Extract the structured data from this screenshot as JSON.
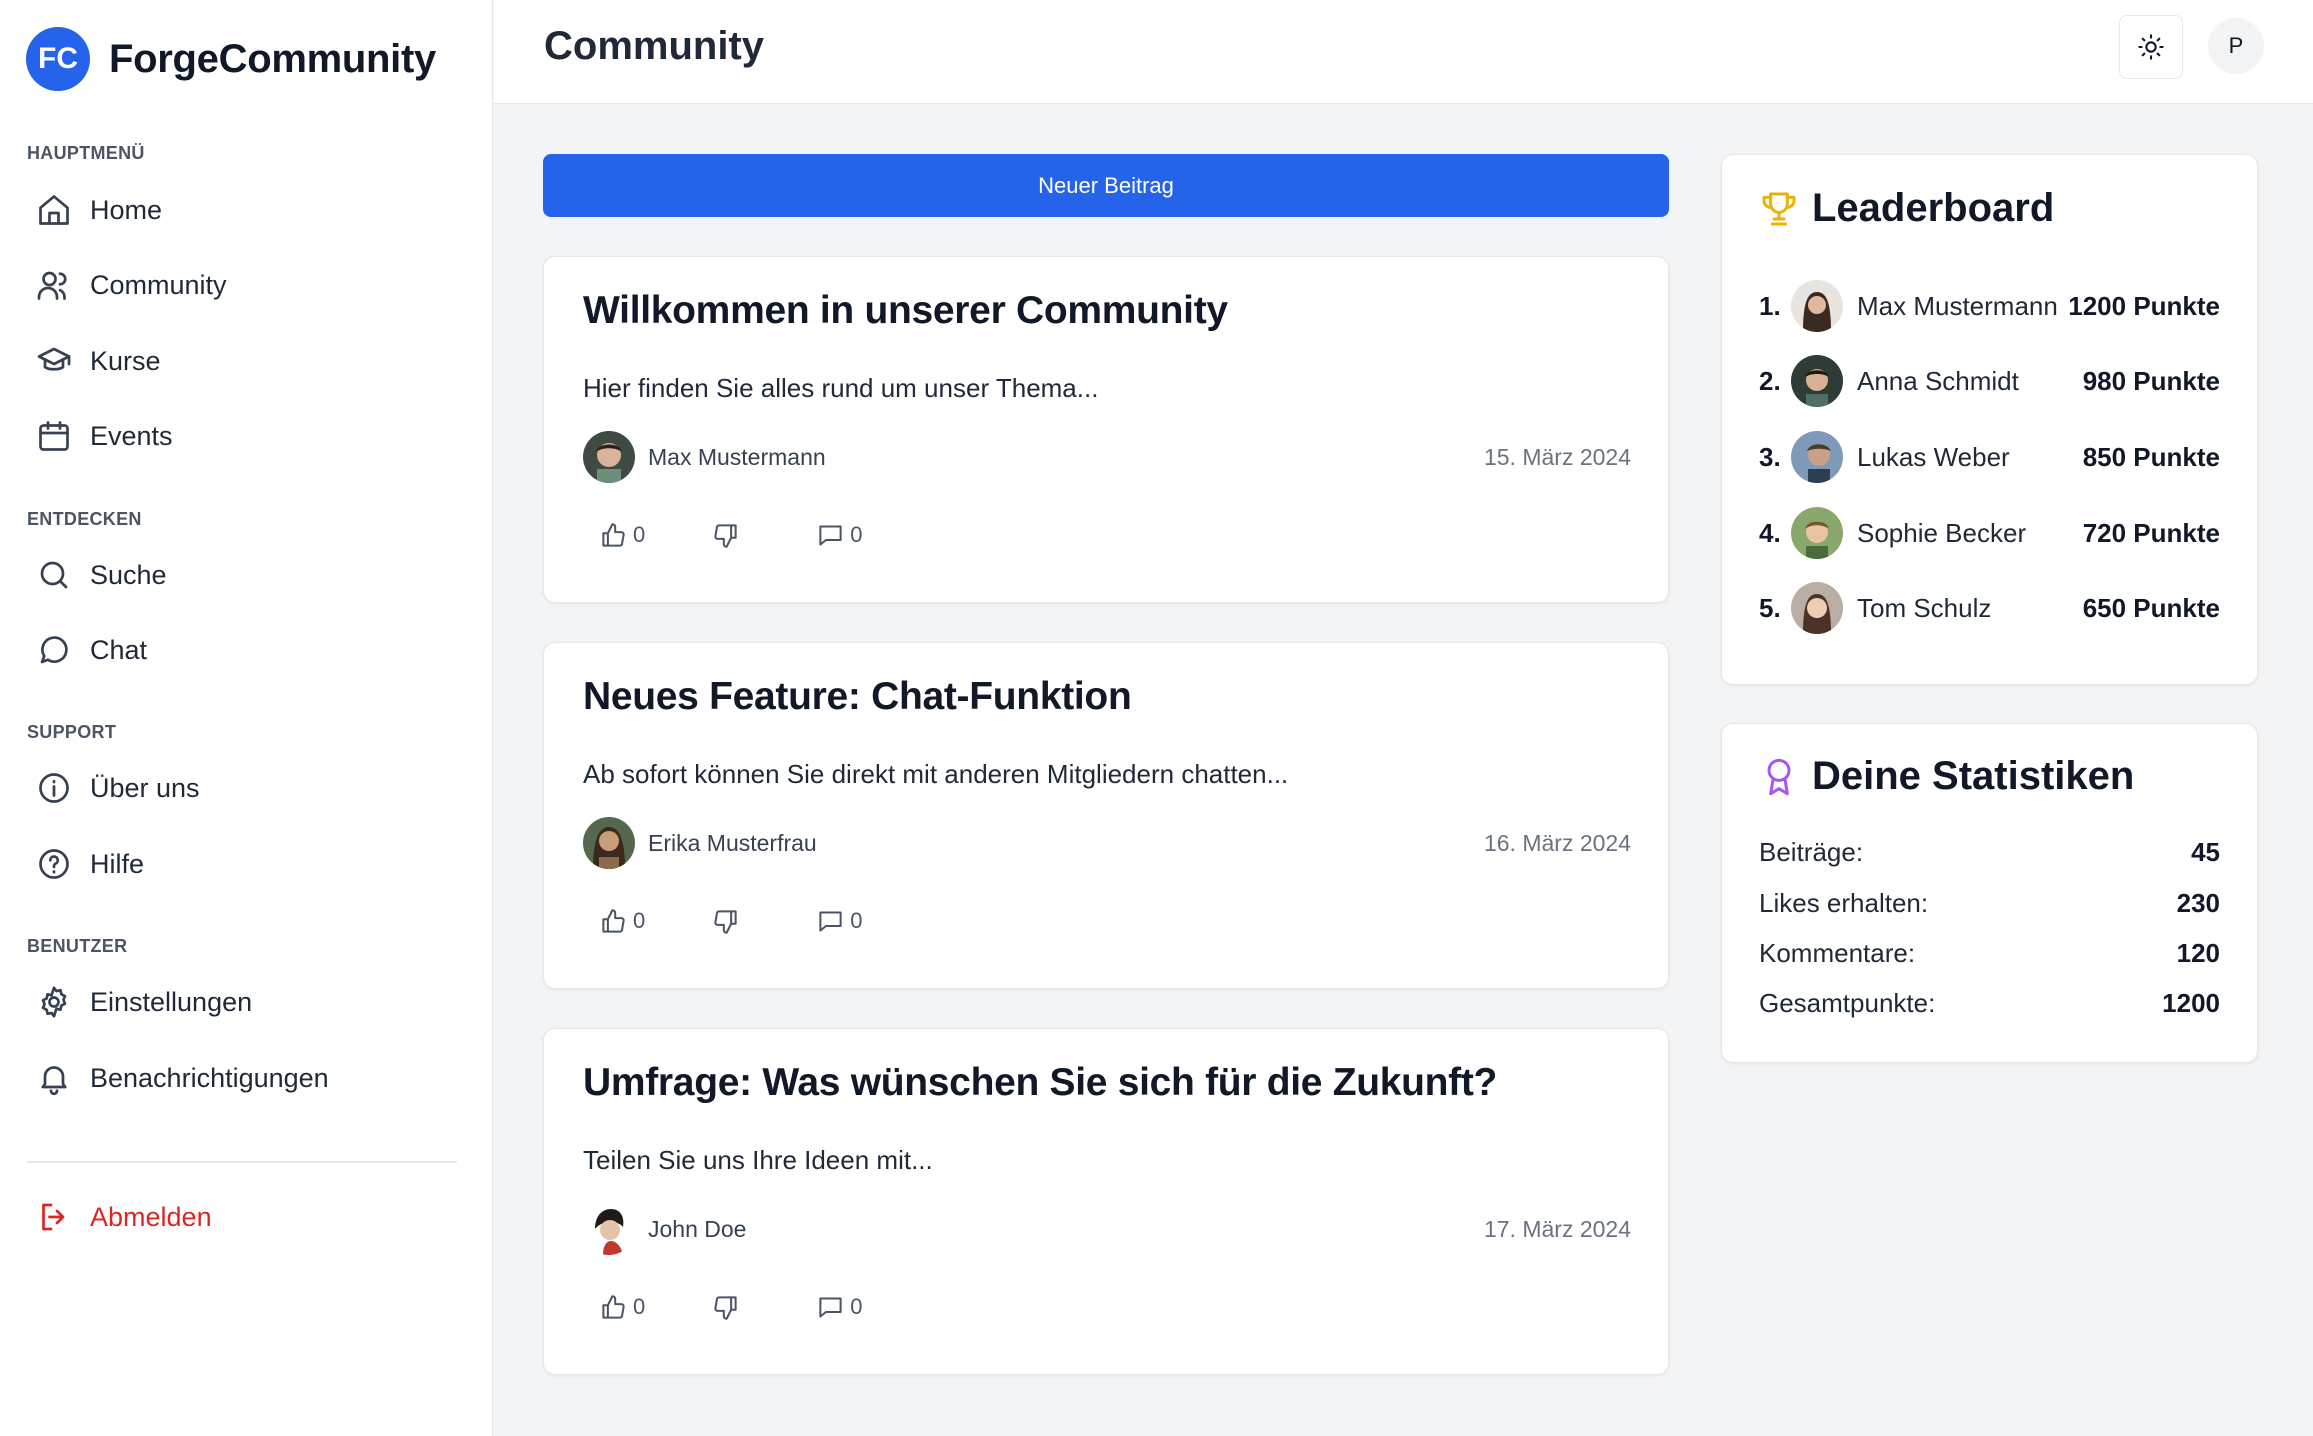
{
  "brand": {
    "logo_text": "FC",
    "name": "ForgeCommunity"
  },
  "sidebar": {
    "sections": [
      {
        "label": "HAUPTMENÜ",
        "items": [
          {
            "label": "Home",
            "icon": "home-icon"
          },
          {
            "label": "Community",
            "icon": "users-icon"
          },
          {
            "label": "Kurse",
            "icon": "graduation-cap-icon"
          },
          {
            "label": "Events",
            "icon": "calendar-icon"
          }
        ]
      },
      {
        "label": "ENTDECKEN",
        "items": [
          {
            "label": "Suche",
            "icon": "search-icon"
          },
          {
            "label": "Chat",
            "icon": "chat-bubble-icon"
          }
        ]
      },
      {
        "label": "SUPPORT",
        "items": [
          {
            "label": "Über uns",
            "icon": "info-icon"
          },
          {
            "label": "Hilfe",
            "icon": "help-icon"
          }
        ]
      },
      {
        "label": "BENUTZER",
        "items": [
          {
            "label": "Einstellungen",
            "icon": "gear-icon"
          },
          {
            "label": "Benachrichtigungen",
            "icon": "bell-icon"
          }
        ]
      }
    ],
    "logout_label": "Abmelden"
  },
  "header": {
    "title": "Community",
    "avatar_initial": "P"
  },
  "new_post_label": "Neuer Beitrag",
  "posts": [
    {
      "title": "Willkommen in unserer Community",
      "excerpt": "Hier finden Sie alles rund um unser Thema...",
      "author": "Max Mustermann",
      "date": "15. März 2024",
      "likes": "0",
      "comments": "0"
    },
    {
      "title": "Neues Feature: Chat-Funktion",
      "excerpt": "Ab sofort können Sie direkt mit anderen Mitgliedern chatten...",
      "author": "Erika Musterfrau",
      "date": "16. März 2024",
      "likes": "0",
      "comments": "0"
    },
    {
      "title": "Umfrage: Was wünschen Sie sich für die Zukunft?",
      "excerpt": "Teilen Sie uns Ihre Ideen mit...",
      "author": "John Doe",
      "date": "17. März 2024",
      "likes": "0",
      "comments": "0"
    }
  ],
  "leaderboard": {
    "title": "Leaderboard",
    "entries": [
      {
        "rank": "1.",
        "name": "Max Mustermann",
        "points": "1200 Punkte"
      },
      {
        "rank": "2.",
        "name": "Anna Schmidt",
        "points": "980 Punkte"
      },
      {
        "rank": "3.",
        "name": "Lukas Weber",
        "points": "850 Punkte"
      },
      {
        "rank": "4.",
        "name": "Sophie Becker",
        "points": "720 Punkte"
      },
      {
        "rank": "5.",
        "name": "Tom Schulz",
        "points": "650 Punkte"
      }
    ]
  },
  "stats": {
    "title": "Deine Statistiken",
    "rows": [
      {
        "label": "Beiträge:",
        "value": "45"
      },
      {
        "label": "Likes erhalten:",
        "value": "230"
      },
      {
        "label": "Kommentare:",
        "value": "120"
      },
      {
        "label": "Gesamtpunkte:",
        "value": "1200"
      }
    ]
  },
  "colors": {
    "accent": "#2563eb",
    "danger": "#dc2626",
    "trophy": "#eab308",
    "award": "#a855f7"
  }
}
